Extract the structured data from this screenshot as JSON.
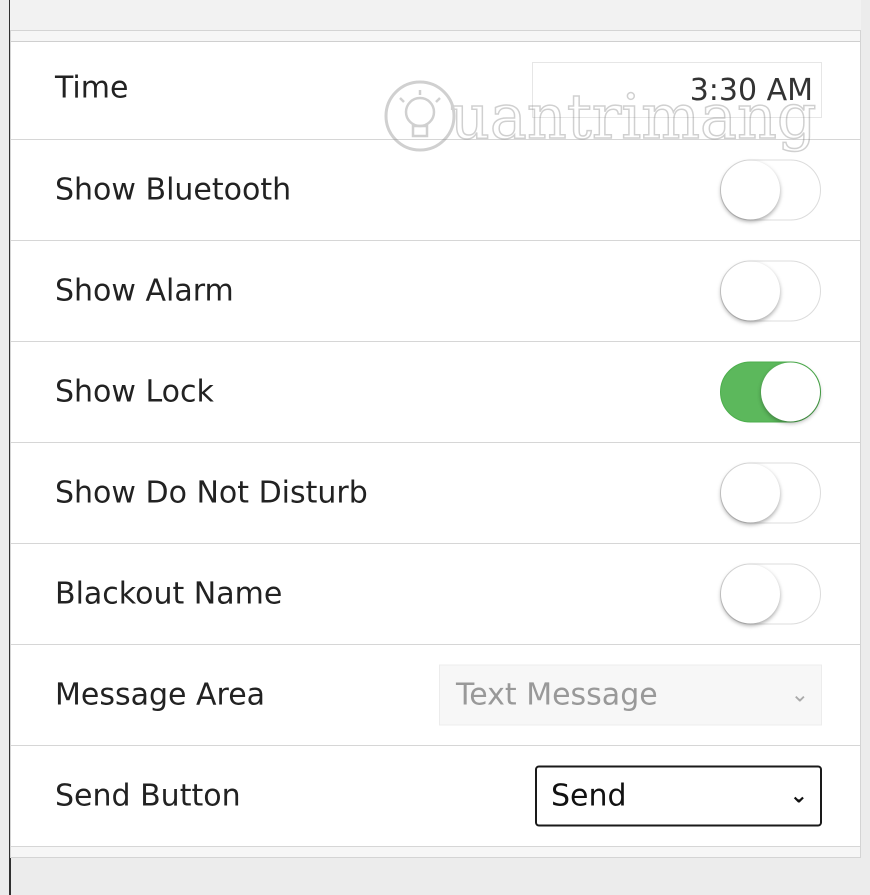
{
  "settings": {
    "time": {
      "label": "Time",
      "value": "3:30 AM"
    },
    "show_bluetooth": {
      "label": "Show Bluetooth",
      "on": false
    },
    "show_alarm": {
      "label": "Show Alarm",
      "on": false
    },
    "show_lock": {
      "label": "Show Lock",
      "on": true
    },
    "show_do_not_disturb": {
      "label": "Show Do Not Disturb",
      "on": false
    },
    "blackout_name": {
      "label": "Blackout Name",
      "on": false
    },
    "message_area": {
      "label": "Message Area",
      "value": "Text Message",
      "disabled": true
    },
    "send_button": {
      "label": "Send Button",
      "value": "Send"
    }
  },
  "watermark": {
    "text": "uantrimang"
  },
  "colors": {
    "toggle_on": "#5cb85c",
    "background": "#ececec"
  },
  "icons": {
    "dropdown": "chevron-down-icon",
    "watermark_logo": "lightbulb-icon"
  }
}
